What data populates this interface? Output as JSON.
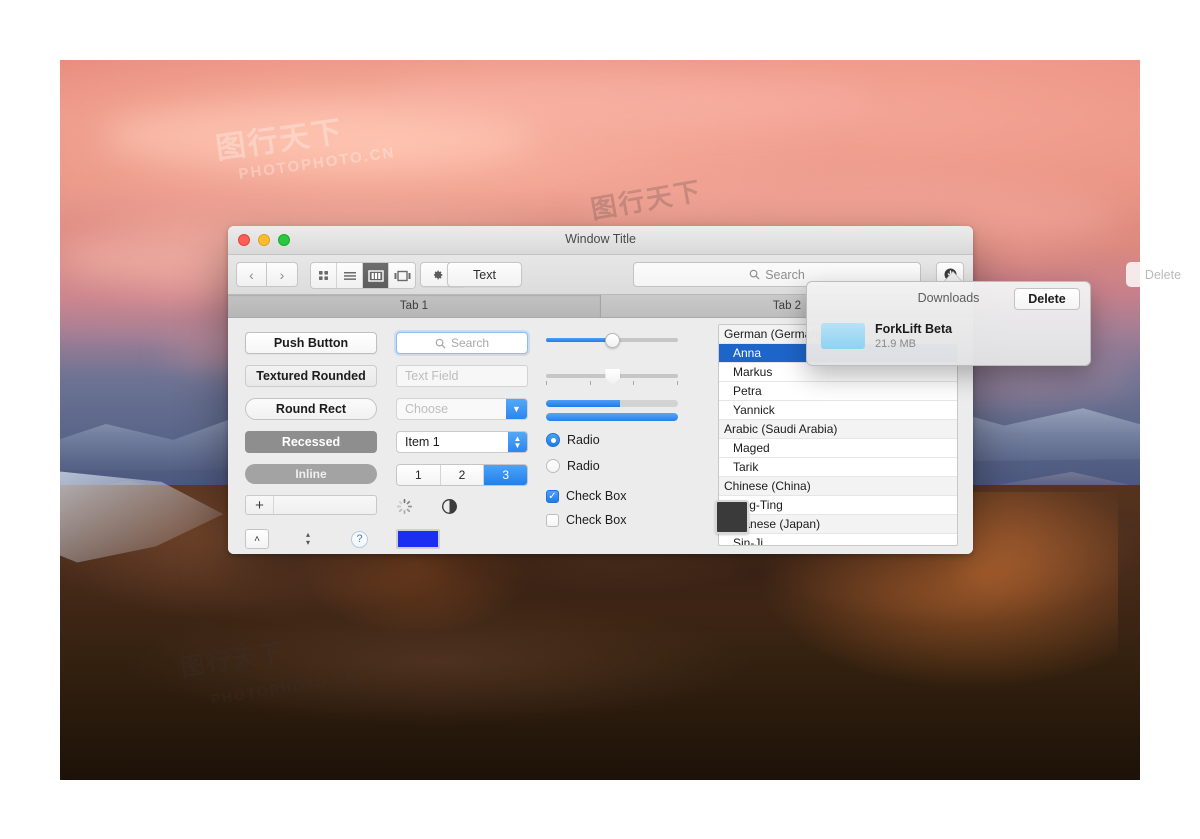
{
  "window": {
    "title": "Window Title",
    "traffic_lights": [
      "close",
      "minimize",
      "zoom"
    ],
    "toolbar": {
      "back_icon": "‹",
      "forward_icon": "›",
      "view_modes": [
        "icon-view",
        "list-view",
        "column-view",
        "gallery-view"
      ],
      "active_view": "column-view",
      "gear_label": "gear",
      "text_button": "Text",
      "search_placeholder": "Search",
      "search_icon": "search-icon",
      "download_icon": "download-icon"
    },
    "tabs": [
      {
        "label": "Tab 1",
        "selected": true
      },
      {
        "label": "Tab 2",
        "selected": false
      }
    ]
  },
  "buttons": {
    "push": "Push Button",
    "textured_rounded": "Textured Rounded",
    "round_rect": "Round Rect",
    "recessed": "Recessed",
    "inline": "Inline",
    "plus": "+",
    "disclosure": "˄",
    "stepper_up": "▴",
    "stepper_down": "▾",
    "help": "?"
  },
  "fields": {
    "search_placeholder": "Search",
    "search_icon": "search-icon",
    "text_placeholder": "Text Field",
    "choose_placeholder": "Choose",
    "popup_value": "Item 1",
    "segmented": [
      "1",
      "2",
      "3"
    ],
    "segmented_selected": "3"
  },
  "indicators": {
    "spinner_label": "progress-spinner",
    "level_label": "level-indicator",
    "color_well_blue": "#1A2FF0",
    "color_well_dark": "#3A3A3A"
  },
  "sliders": {
    "continuous_value": 52,
    "tick_value": 50,
    "tick_count": 4,
    "progress_value": 56,
    "progress_indeterminate": 100
  },
  "choices": {
    "radios": [
      {
        "label": "Radio",
        "selected": true
      },
      {
        "label": "Radio",
        "selected": false
      }
    ],
    "checkboxes": [
      {
        "label": "Check Box",
        "checked": true
      },
      {
        "label": "Check Box",
        "checked": false
      }
    ]
  },
  "voices_list": [
    {
      "label": "German (Germany)",
      "type": "group",
      "selected": false
    },
    {
      "label": "Anna",
      "type": "child",
      "selected": true
    },
    {
      "label": "Markus",
      "type": "child",
      "selected": false
    },
    {
      "label": "Petra",
      "type": "child",
      "selected": false
    },
    {
      "label": "Yannick",
      "type": "child",
      "selected": false
    },
    {
      "label": "Arabic (Saudi Arabia)",
      "type": "group",
      "selected": false
    },
    {
      "label": "Maged",
      "type": "child",
      "selected": false
    },
    {
      "label": "Tarik",
      "type": "child",
      "selected": false
    },
    {
      "label": "Chinese (China)",
      "type": "group",
      "selected": false
    },
    {
      "label": "Ting-Ting",
      "type": "child",
      "selected": false
    },
    {
      "label": "Japanese (Japan)",
      "type": "group",
      "selected": false
    },
    {
      "label": "Sin-Ji",
      "type": "child",
      "selected": false
    }
  ],
  "popover": {
    "title": "Downloads",
    "delete_label": "Delete",
    "item_name": "ForkLift Beta",
    "item_size": "21.9 MB"
  },
  "ghost": {
    "delete_label": "Delete"
  },
  "watermarks": {
    "brand_cn": "PHOTOPHOTO.CN",
    "brand_short": "图行天下"
  },
  "colors": {
    "accent_blue": "#1F7CE8",
    "selection_blue": "#1D65C9",
    "recessed_gray": "#8E8E8E",
    "inline_gray": "#A3A3A3"
  }
}
